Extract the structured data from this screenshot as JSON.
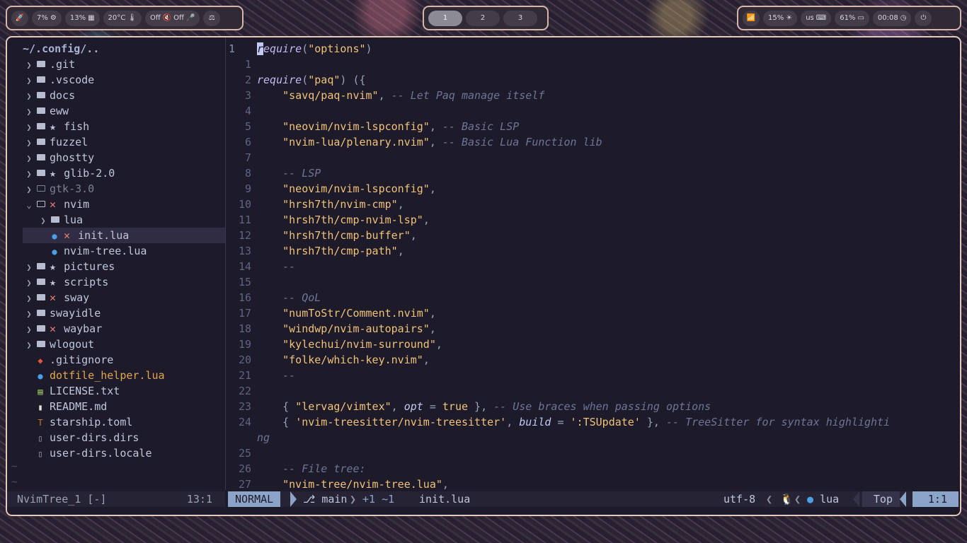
{
  "bar_left": {
    "launcher_icon": "rocket-icon",
    "cpu": "7%",
    "mem": "13%",
    "temp": "20°C",
    "audio_out": "Off",
    "audio_in": "Off",
    "balance_icon": "balance-icon"
  },
  "bar_center": {
    "workspaces": [
      "1",
      "2",
      "3"
    ],
    "active": "1"
  },
  "bar_right": {
    "wifi_icon": "wifi-icon",
    "brightness": "15%",
    "layout": "us",
    "battery": "61%",
    "clock": "00:08",
    "power_icon": "power-icon"
  },
  "tree": {
    "title": "~/.config/..",
    "items": [
      {
        "label": ".git"
      },
      {
        "label": ".vscode"
      },
      {
        "label": "docs"
      },
      {
        "label": "eww"
      },
      {
        "label": "fish",
        "mark": "★"
      },
      {
        "label": "fuzzel"
      },
      {
        "label": "ghostty"
      },
      {
        "label": "glib-2.0",
        "mark": "★"
      },
      {
        "label": "gtk-3.0"
      },
      {
        "label": "nvim",
        "mark": "✕"
      },
      {
        "label": "lua"
      },
      {
        "label": "init.lua",
        "mark": "✕"
      },
      {
        "label": "nvim-tree.lua"
      },
      {
        "label": "pictures",
        "mark": "★"
      },
      {
        "label": "scripts",
        "mark": "★"
      },
      {
        "label": "sway",
        "mark": "✕"
      },
      {
        "label": "swayidle"
      },
      {
        "label": "waybar",
        "mark": "✕"
      },
      {
        "label": "wlogout"
      },
      {
        "label": ".gitignore"
      },
      {
        "label": "dotfile_helper.lua"
      },
      {
        "label": "LICENSE.txt"
      },
      {
        "label": "README.md"
      },
      {
        "label": "starship.toml"
      },
      {
        "label": "user-dirs.dirs"
      },
      {
        "label": "user-dirs.locale"
      }
    ],
    "tildes": [
      "~",
      "~"
    ]
  },
  "code": {
    "line_numbers": [
      "1",
      "1",
      "2",
      "3",
      "4",
      "5",
      "6",
      "7",
      "8",
      "9",
      "10",
      "11",
      "12",
      "13",
      "14",
      "15",
      "16",
      "17",
      "18",
      "19",
      "20",
      "21",
      "22",
      "23",
      "24",
      "",
      "25",
      "26",
      "27"
    ],
    "lines": {
      "l0_kw": "require",
      "l0_str": "\"options\"",
      "l2_kw": "require",
      "l2_str": "\"paq\"",
      "l3_str": "\"savq/paq-nvim\"",
      "l3_cm": "-- Let Paq manage itself",
      "l5_str": "\"neovim/nvim-lspconfig\"",
      "l5_cm": "-- Basic LSP",
      "l6_str": "\"nvim-lua/plenary.nvim\"",
      "l6_cm": "-- Basic Lua Function lib",
      "l8_cm": "-- LSP",
      "l9_str": "\"neovim/nvim-lspconfig\"",
      "l10_str": "\"hrsh7th/nvim-cmp\"",
      "l11_str": "\"hrsh7th/cmp-nvim-lsp\"",
      "l12_str": "\"hrsh7th/cmp-buffer\"",
      "l13_str": "\"hrsh7th/cmp-path\"",
      "l14_cm": "--",
      "l16_cm": "-- QoL",
      "l17_str": "\"numToStr/Comment.nvim\"",
      "l18_str": "\"windwp/nvim-autopairs\"",
      "l19_str": "\"kylechui/nvim-surround\"",
      "l20_str": "\"folke/which-key.nvim\"",
      "l21_cm": "--",
      "l23_str": "\"lervag/vimtex\"",
      "l23_id": "opt",
      "l23_bool": "true",
      "l23_cm": "-- Use braces when passing options",
      "l24_str": "'nvim-treesitter/nvim-treesitter'",
      "l24_id": "build",
      "l24_val": "':TSUpdate'",
      "l24_cm": "-- TreeSitter for syntax highlighti",
      "l24b_cm": "ng",
      "l26_cm": "-- File tree:",
      "l27_str": "\"nvim-tree/nvim-tree.lua\""
    }
  },
  "status_left": {
    "name": "NvimTree_1 [-]",
    "pos": "13:1"
  },
  "status_right": {
    "mode": "NORMAL",
    "branch": "main",
    "diff": "+1 ~1",
    "file": "init.lua",
    "encoding": "utf-8",
    "filetype": "lua",
    "scroll": "Top",
    "pos": "1:1"
  },
  "colors": {
    "accent": "#8ba4c8",
    "border": "#e6c9bd",
    "editor_bg": "#1d1b29"
  }
}
